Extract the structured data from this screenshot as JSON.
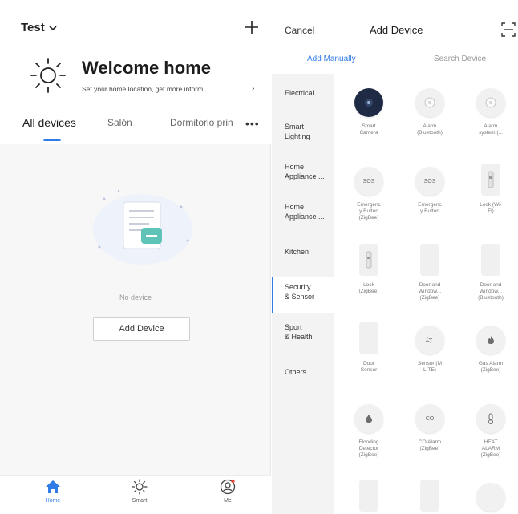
{
  "home": {
    "name": "Test",
    "welcome_title": "Welcome home",
    "welcome_subtitle": "Set your home location, get more inform...",
    "tabs": [
      "All devices",
      "Salón",
      "Dormitorio prin"
    ],
    "empty_text": "No device",
    "add_device_label": "Add Device",
    "nav": [
      {
        "label": "Home",
        "icon": "home-icon"
      },
      {
        "label": "Smart",
        "icon": "sun-icon"
      },
      {
        "label": "Me",
        "icon": "user-icon"
      }
    ],
    "accent_color": "#2f7be8"
  },
  "add_device": {
    "cancel_label": "Cancel",
    "title": "Add Device",
    "tabs": [
      "Add Manually",
      "Search Device"
    ],
    "categories": [
      "Electrical",
      "Smart\nLighting",
      "Home\nAppliance ...",
      "Home\nAppliance ...",
      "Kitchen",
      "Security\n& Sensor",
      "Sport\n& Health",
      "Others"
    ],
    "active_category": "Security & Sensor",
    "devices": [
      {
        "name": "Smart\nCamera",
        "icon": "camera-icon",
        "badge": ""
      },
      {
        "name": "Alarm\n(Bluetooth)",
        "icon": "alarm-icon",
        "badge": ""
      },
      {
        "name": "Alarm\nsystem (...",
        "icon": "alarm-icon",
        "badge": ""
      },
      {
        "name": "Emergenc\ny Button\n(ZigBee)",
        "icon": "sos-icon",
        "badge": "SOS"
      },
      {
        "name": "Emergenc\ny Button",
        "icon": "sos-icon",
        "badge": "SOS"
      },
      {
        "name": "Lock (Wi-\nFi)",
        "icon": "lock-icon",
        "badge": ""
      },
      {
        "name": "Lock\n(ZigBee)",
        "icon": "lock-icon",
        "badge": ""
      },
      {
        "name": "Door and\nWindow...\n(ZigBee)",
        "icon": "door-sensor-icon",
        "badge": ""
      },
      {
        "name": "Door and\nWindow...\n(Bluetooth)",
        "icon": "door-sensor-icon",
        "badge": ""
      },
      {
        "name": "Door\nSensor",
        "icon": "door-sensor-icon",
        "badge": ""
      },
      {
        "name": "Sensor (M\nLITE)",
        "icon": "sensor-icon",
        "badge": ""
      },
      {
        "name": "Gas Alarm\n(ZigBee)",
        "icon": "flame-icon",
        "badge": ""
      },
      {
        "name": "Flooding\nDetector\n(ZigBee)",
        "icon": "water-drop-icon",
        "badge": ""
      },
      {
        "name": "CO Alarm\n(ZigBee)",
        "icon": "co-icon",
        "badge": "CO"
      },
      {
        "name": "HEAT\nALARM\n(ZigBee)",
        "icon": "thermometer-icon",
        "badge": ""
      },
      {
        "name": "",
        "icon": "device-icon",
        "badge": ""
      },
      {
        "name": "",
        "icon": "device-icon",
        "badge": ""
      },
      {
        "name": "",
        "icon": "device-icon",
        "badge": ""
      }
    ]
  }
}
